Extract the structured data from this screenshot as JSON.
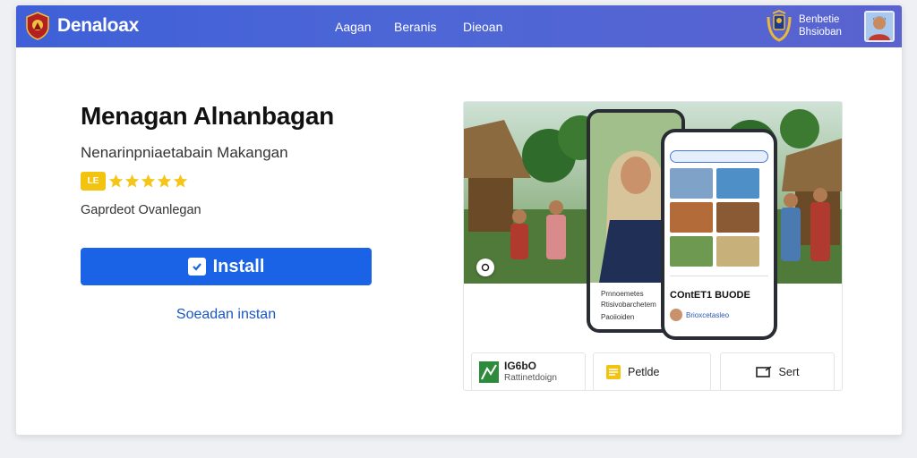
{
  "header": {
    "brand": "Denaloax",
    "nav": [
      "Aagan",
      "Beranis",
      "Dieoan"
    ],
    "user_line1": "Benbetie",
    "user_line2": "Bhsioban"
  },
  "app": {
    "title": "Menagan Alnanbagan",
    "subtitle": "Nenarinpniaetabain Makangan",
    "rating_badge": "LE",
    "rating_stars": 5,
    "developer": "Gaprdeot Ovanlegan",
    "install_label": "Install",
    "instant_label": "Soeadan instan"
  },
  "preview": {
    "back_phone_lines": [
      "Prnnoemetes",
      "Rtisivobarchetem",
      "Paoiioiden"
    ],
    "front_phone_caption": "COntET1 BUODE",
    "front_phone_subcaption": "Brioxcetasleo"
  },
  "bottom_cards": {
    "card1_line1": "IG6bO",
    "card1_line2": "Rattinetdoign",
    "card2_label": "Petlde",
    "card3_label": "Sert"
  },
  "colors": {
    "header_gradient_start": "#3f60d8",
    "header_gradient_end": "#5a63cf",
    "install_button": "#1a63e6",
    "link": "#1a56c4",
    "star": "#f5c518"
  },
  "icons": [
    "brand-logo-icon",
    "emblem-icon",
    "avatar-icon",
    "install-icon",
    "play-icon",
    "map-icon",
    "folder-icon",
    "share-icon"
  ]
}
